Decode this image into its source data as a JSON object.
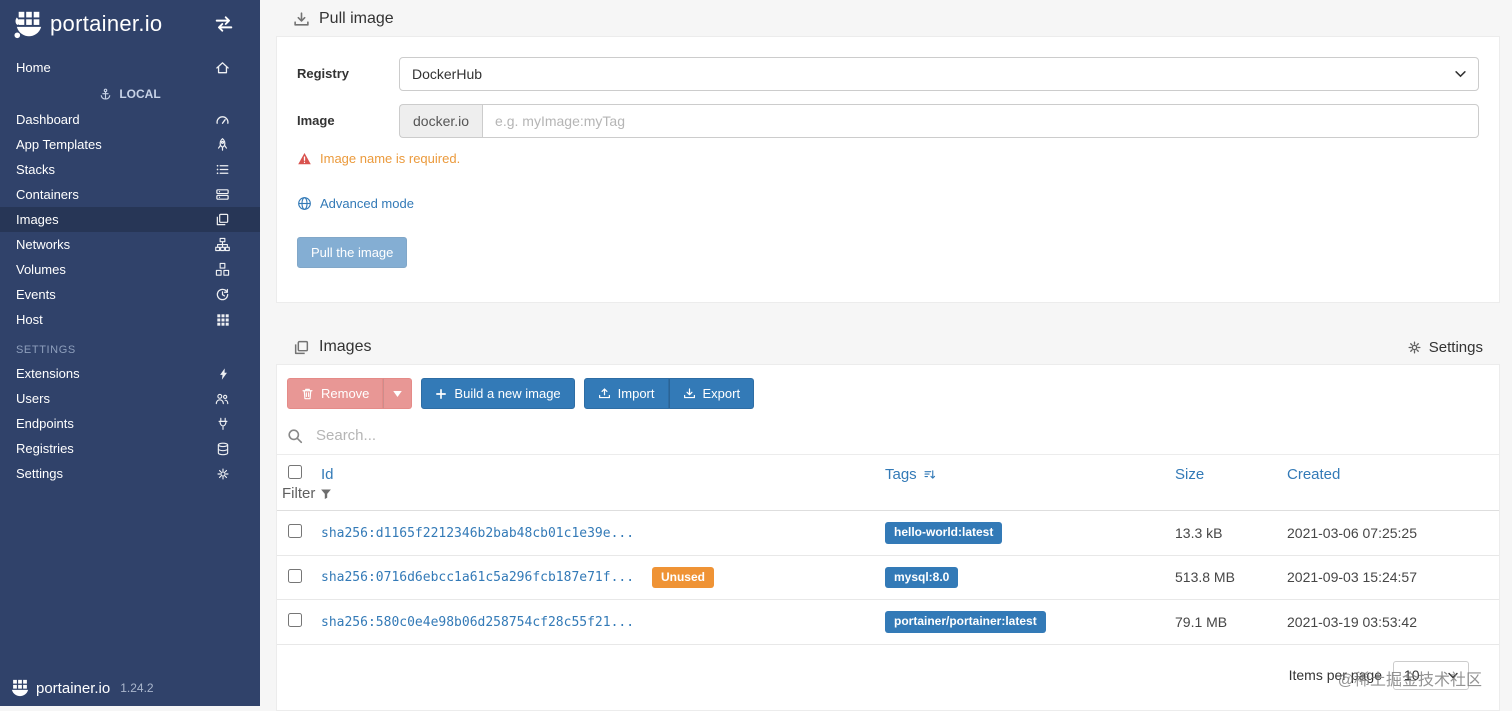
{
  "sidebar": {
    "logo_text": "portainer.io",
    "home_label": "Home",
    "endpoint_label": "LOCAL",
    "items": [
      {
        "label": "Dashboard"
      },
      {
        "label": "App Templates"
      },
      {
        "label": "Stacks"
      },
      {
        "label": "Containers"
      },
      {
        "label": "Images"
      },
      {
        "label": "Networks"
      },
      {
        "label": "Volumes"
      },
      {
        "label": "Events"
      },
      {
        "label": "Host"
      }
    ],
    "settings_header": "SETTINGS",
    "settings_items": [
      {
        "label": "Extensions"
      },
      {
        "label": "Users"
      },
      {
        "label": "Endpoints"
      },
      {
        "label": "Registries"
      },
      {
        "label": "Settings"
      }
    ],
    "footer_logo_text": "portainer.io",
    "version": "1.24.2"
  },
  "pull_image": {
    "title": "Pull image",
    "registry_label": "Registry",
    "registry_value": "DockerHub",
    "image_label": "Image",
    "image_addon": "docker.io",
    "image_placeholder": "e.g. myImage:myTag",
    "warning_text": "Image name is required.",
    "advanced_mode_label": "Advanced mode",
    "pull_button_label": "Pull the image"
  },
  "images_panel": {
    "title": "Images",
    "settings_label": "Settings",
    "remove_label": "Remove",
    "build_label": "Build a new image",
    "import_label": "Import",
    "export_label": "Export",
    "search_placeholder": "Search...",
    "filter_label": "Filter",
    "columns": {
      "id": "Id",
      "tags": "Tags",
      "size": "Size",
      "created": "Created"
    },
    "rows": [
      {
        "id": "sha256:d1165f2212346b2bab48cb01c1e39e...",
        "tag": "hello-world:latest",
        "size": "13.3 kB",
        "created": "2021-03-06 07:25:25"
      },
      {
        "id": "sha256:0716d6ebcc1a61c5a296fcb187e71f...",
        "unused_badge": "Unused",
        "tag": "mysql:8.0",
        "size": "513.8 MB",
        "created": "2021-09-03 15:24:57"
      },
      {
        "id": "sha256:580c0e4e98b06d258754cf28c55f21...",
        "tag": "portainer/portainer:latest",
        "size": "79.1 MB",
        "created": "2021-03-19 03:53:42"
      }
    ],
    "items_per_page_label": "Items per page",
    "items_per_page_value": "10"
  },
  "watermark": "@稀土掘金技术社区",
  "colors": {
    "sidebar_bg": "#30426a",
    "primary": "#337ab7",
    "danger": "#d9534f",
    "unused_badge": "#ef9335",
    "warning_text": "#eb9a3c"
  }
}
